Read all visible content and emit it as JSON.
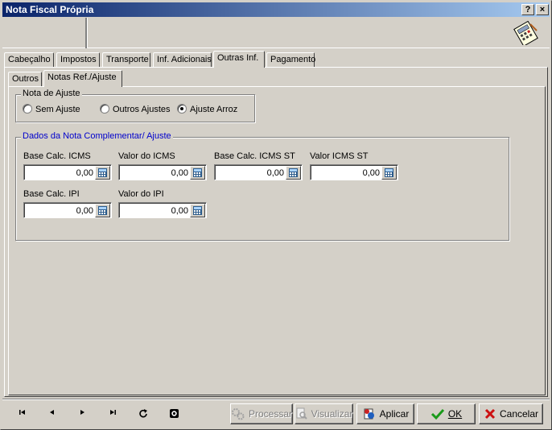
{
  "window": {
    "title": "Nota Fiscal Própria",
    "help_label": "?",
    "close_label": "×"
  },
  "tabs": [
    "Cabeçalho",
    "Impostos",
    "Transporte",
    "Inf. Adicionais",
    "Outras Inf.",
    "Pagamento"
  ],
  "subtabs": [
    "Outros",
    "Notas Ref./Ajuste"
  ],
  "ajuste_group": {
    "title": "Nota de Ajuste",
    "options": [
      "Sem Ajuste",
      "Outros Ajustes",
      "Ajuste Arroz"
    ],
    "selected": "Ajuste Arroz"
  },
  "dados_group": {
    "title": "Dados da Nota Complementar/ Ajuste",
    "fields": [
      {
        "label": "Base Calc. ICMS",
        "value": "0,00"
      },
      {
        "label": "Valor do ICMS",
        "value": "0,00"
      },
      {
        "label": "Base Calc. ICMS ST",
        "value": "0,00"
      },
      {
        "label": "Valor ICMS ST",
        "value": "0,00"
      },
      {
        "label": "Base Calc. IPI",
        "value": "0,00"
      },
      {
        "label": "Valor do IPI",
        "value": "0,00"
      }
    ]
  },
  "nav_icons": [
    "first-record-icon",
    "previous-record-icon",
    "next-record-icon",
    "last-record-icon",
    "refresh-icon",
    "record-icon"
  ],
  "buttons": {
    "processar": "Processar",
    "visualizar": "Visualizar",
    "aplicar": "Aplicar",
    "ok": "OK",
    "cancelar": "Cancelar"
  },
  "colors": {
    "title_start": "#0a246a",
    "title_end": "#a6caf0",
    "group_title": "#0000cc",
    "ok_check": "#1a9a1a",
    "cancel_x": "#cc1111"
  }
}
